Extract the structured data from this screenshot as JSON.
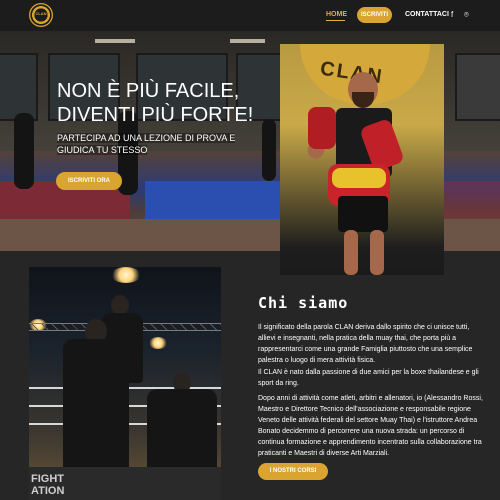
{
  "header": {
    "logo_alt": "CLAN",
    "nav": {
      "home": "HOME",
      "signup": "ISCRIVITI",
      "contact": "CONTATTACI"
    },
    "social": [
      "f",
      "⌾"
    ]
  },
  "hero": {
    "title_line1": "NON È PIÙ FACILE,",
    "title_line2": "DIVENTI PIÙ FORTE!",
    "subtitle": "PARTECIPA AD UNA LEZIONE DI PROVA E GIUDICA TU STESSO",
    "cta": "ISCRIVITI ORA",
    "photo_banner": "CLAN"
  },
  "about": {
    "title": "Chi siamo",
    "p1": "Il significato della parola CLAN deriva dallo spirito che ci unisce tutti, allievi e insegnanti, nella pratica della muay thai, che porta più a rappresentarci come una grande Famiglia piuttosto che una semplice palestra o luogo di mera attività fisica.",
    "p2": "Il CLAN è nato dalla passione di due amici per la boxe thailandese e gli sport da ring.",
    "p3": "Dopo anni di attività come atleti, arbitri e allenatori, io (Alessandro Rossi, Maestro e Direttore Tecnico dell'associazione e responsabile regione Veneto delle attività federali del settore Muay Thai) e l'istruttore Andrea Bonato decidemmo di percorrere una nuova strada: un percorso di continua formazione e apprendimento incentrato sulla collaborazione tra praticanti e Maestri di diverse Arti Marziali.",
    "cta": "I NOSTRI CORSI",
    "photo_text": "FIGHT\nATION"
  },
  "colors": {
    "accent": "#d9a530",
    "background": "#262626",
    "header": "#1c1c1c"
  }
}
